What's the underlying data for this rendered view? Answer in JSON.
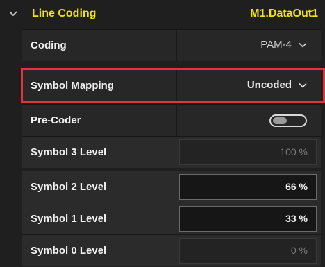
{
  "section": {
    "title": "Line Coding",
    "target": "M1.DataOut1"
  },
  "rows": [
    {
      "label": "Coding",
      "type": "dropdown",
      "value": "PAM-4"
    },
    {
      "label": "Symbol Mapping",
      "type": "dropdown",
      "value": "Uncoded",
      "highlighted": true
    },
    {
      "label": "Pre-Coder",
      "type": "toggle",
      "on": false
    },
    {
      "label": "Symbol 3 Level",
      "type": "number",
      "value": "100 %",
      "editable": false
    },
    {
      "label": "Symbol 2 Level",
      "type": "number",
      "value": "66 %",
      "editable": true
    },
    {
      "label": "Symbol 1 Level",
      "type": "number",
      "value": "33 %",
      "editable": true
    },
    {
      "label": "Symbol 0 Level",
      "type": "number",
      "value": "0 %",
      "editable": false
    }
  ],
  "colors": {
    "accent": "#f2e600",
    "highlight_border": "#e0353f",
    "background": "#1f1f1f"
  }
}
